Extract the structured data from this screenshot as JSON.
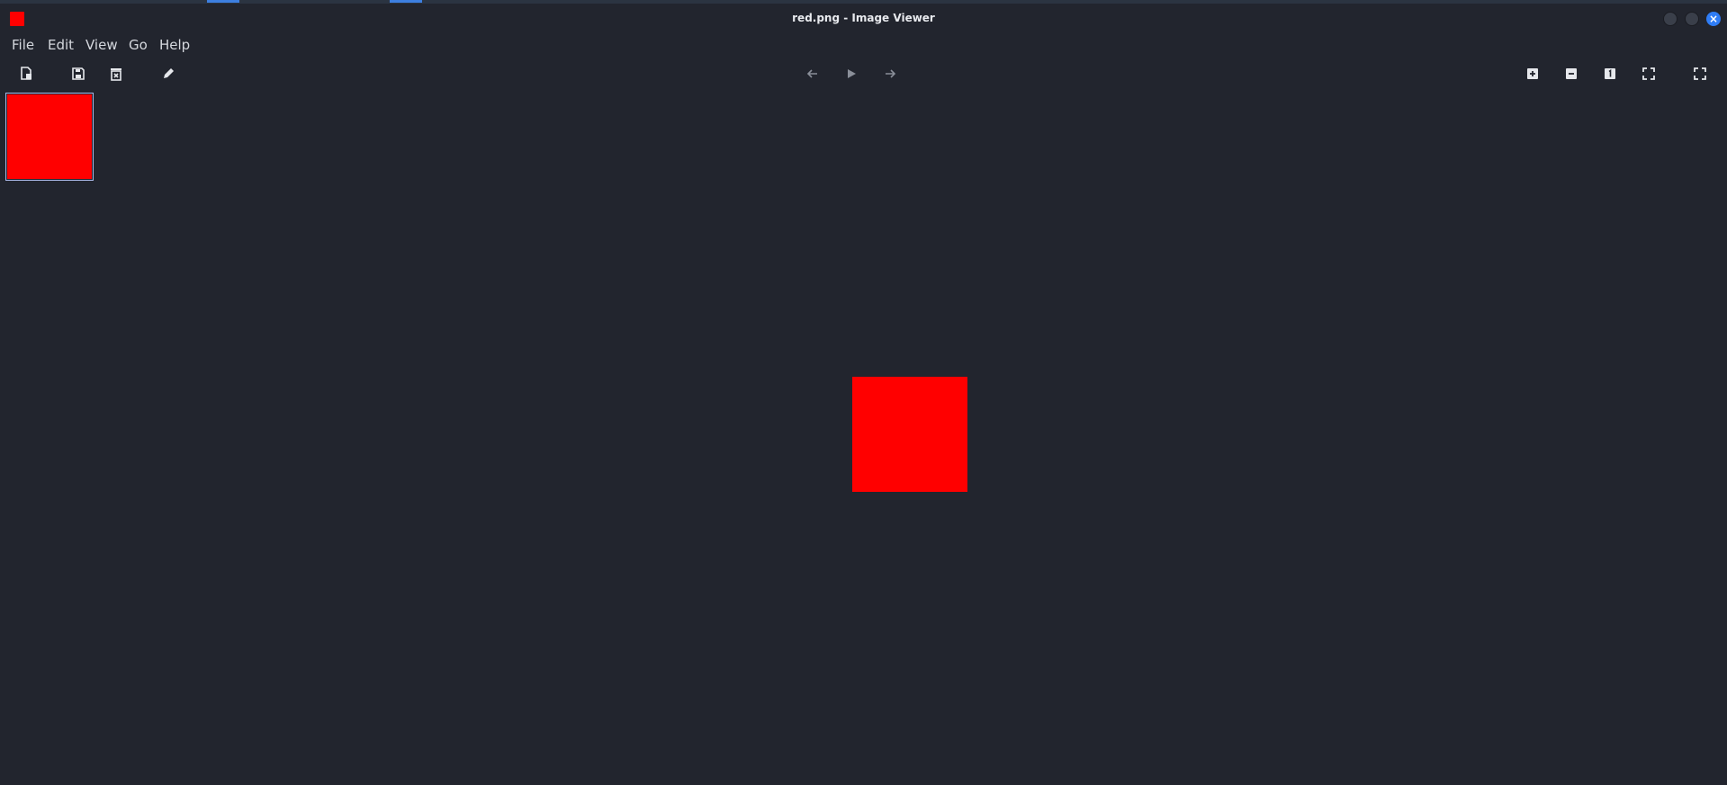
{
  "window": {
    "title": "red.png - Image Viewer"
  },
  "menu": {
    "items": [
      "File",
      "Edit",
      "View",
      "Go",
      "Help"
    ]
  },
  "toolbar": {
    "left_icons": [
      "open-file-icon",
      "save-icon",
      "delete-icon",
      "edit-icon"
    ],
    "nav_icons": [
      "previous-icon",
      "play-icon",
      "next-icon"
    ],
    "zoom_icons": [
      "zoom-in-icon",
      "zoom-out-icon",
      "zoom-normal-icon",
      "zoom-fit-icon",
      "fullscreen-icon"
    ]
  },
  "image": {
    "filename": "red.png",
    "color": "#ff0000"
  },
  "colors": {
    "background": "#22252e",
    "accent": "#2f7df6",
    "selection_border": "#a9b7e6"
  }
}
